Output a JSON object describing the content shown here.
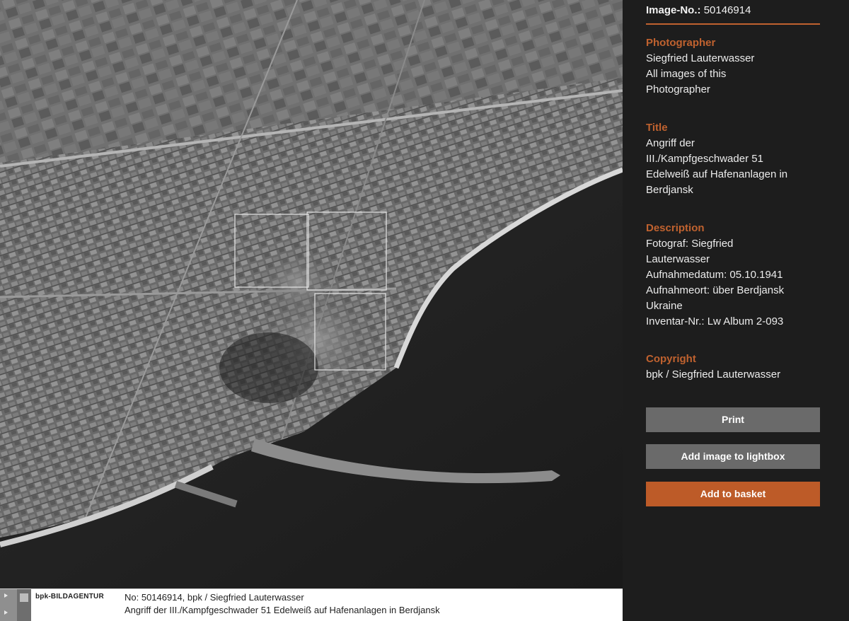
{
  "caption": {
    "brand": "bpk-BILDAGENTUR",
    "line1": "No: 50146914, bpk / Siegfried Lauterwasser",
    "line2": "Angriff der III./Kampfgeschwader 51 Edelweiß auf Hafenanlagen in Berdjansk"
  },
  "panel": {
    "image_no_label": "Image-No.:",
    "image_no_value": "50146914",
    "photographer": {
      "label": "Photographer",
      "name": "Siegfried Lauterwasser",
      "all_images_line1": "All images of this",
      "all_images_line2": "Photographer"
    },
    "title": {
      "label": "Title",
      "lines": [
        "Angriff der",
        "III./Kampfgeschwader 51",
        "Edelweiß auf Hafenanlagen in",
        "Berdjansk"
      ]
    },
    "description": {
      "label": "Description",
      "lines": [
        "Fotograf: Siegfried",
        "Lauterwasser",
        "Aufnahmedatum: 05.10.1941",
        "Aufnahmeort: über Berdjansk",
        "Ukraine",
        "Inventar-Nr.: Lw Album 2-093"
      ]
    },
    "copyright": {
      "label": "Copyright",
      "text": "bpk / Siegfried Lauterwasser"
    },
    "buttons": {
      "print": "Print",
      "lightbox": "Add image to lightbox",
      "basket": "Add to basket"
    }
  },
  "colors": {
    "accent": "#c0622f",
    "basket_button": "#bd5b28",
    "grey_button": "#6a6a6a",
    "panel_bg": "#1d1d1d"
  }
}
